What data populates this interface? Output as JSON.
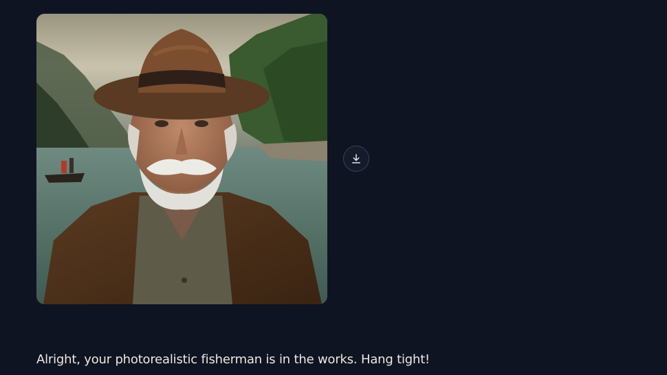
{
  "image": {
    "alt": "photorealistic fisherman"
  },
  "download": {
    "icon": "download-icon"
  },
  "message": {
    "text": "Alright, your photorealistic fisherman is in the works. Hang tight!"
  },
  "colors": {
    "background": "#0f1422",
    "text": "#ece9e2",
    "button_border": "#3a4254"
  }
}
